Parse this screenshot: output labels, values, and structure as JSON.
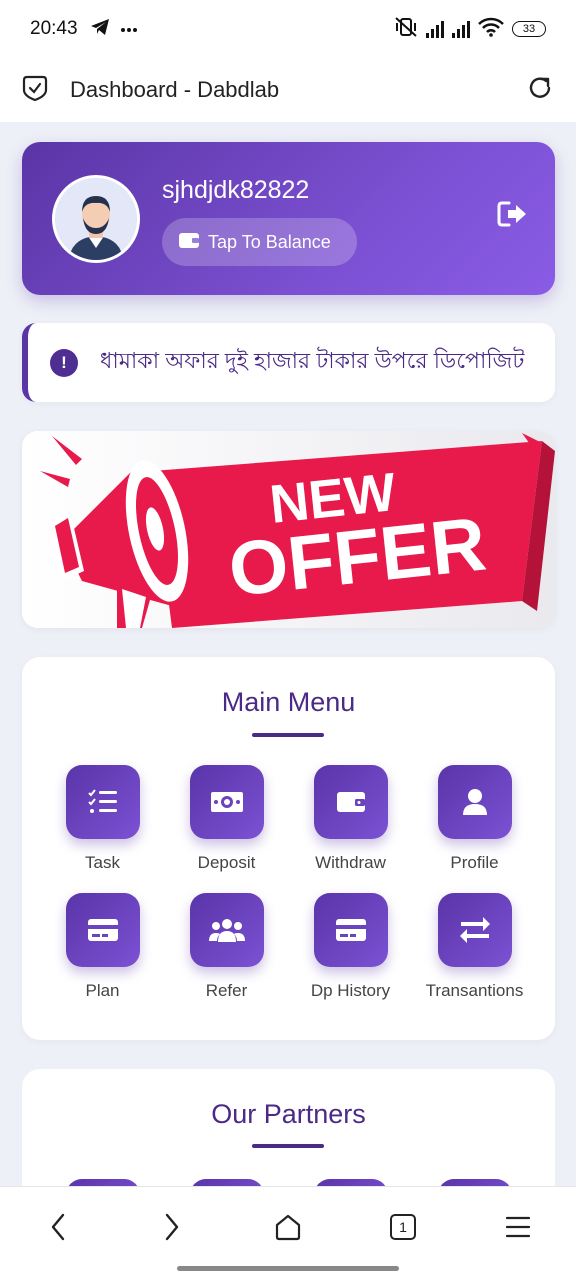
{
  "status_bar": {
    "time": "20:43",
    "battery": "33"
  },
  "header": {
    "title": "Dashboard - Dabdlab"
  },
  "profile": {
    "username": "sjhdjdk82822",
    "balance_button": "Tap To Balance"
  },
  "notice": {
    "text": "ধামাকা অফার দুই হাজার টাকার উপরে ডিপোজিট"
  },
  "banner": {
    "line1": "NEW",
    "line2": "OFFER"
  },
  "main_menu": {
    "title": "Main Menu",
    "items": [
      {
        "label": "Task",
        "icon": "task-list-icon"
      },
      {
        "label": "Deposit",
        "icon": "money-icon"
      },
      {
        "label": "Withdraw",
        "icon": "wallet-icon"
      },
      {
        "label": "Profile",
        "icon": "user-icon"
      },
      {
        "label": "Plan",
        "icon": "credit-card-icon"
      },
      {
        "label": "Refer",
        "icon": "users-icon"
      },
      {
        "label": "Dp History",
        "icon": "credit-card-icon"
      },
      {
        "label": "Transantions",
        "icon": "exchange-icon"
      }
    ]
  },
  "partners": {
    "title": "Our Partners"
  },
  "browser_nav": {
    "tab_count": "1"
  },
  "colors": {
    "primary": "#5b35a6",
    "accent": "#8a5ce6",
    "banner_red": "#e8194b"
  }
}
